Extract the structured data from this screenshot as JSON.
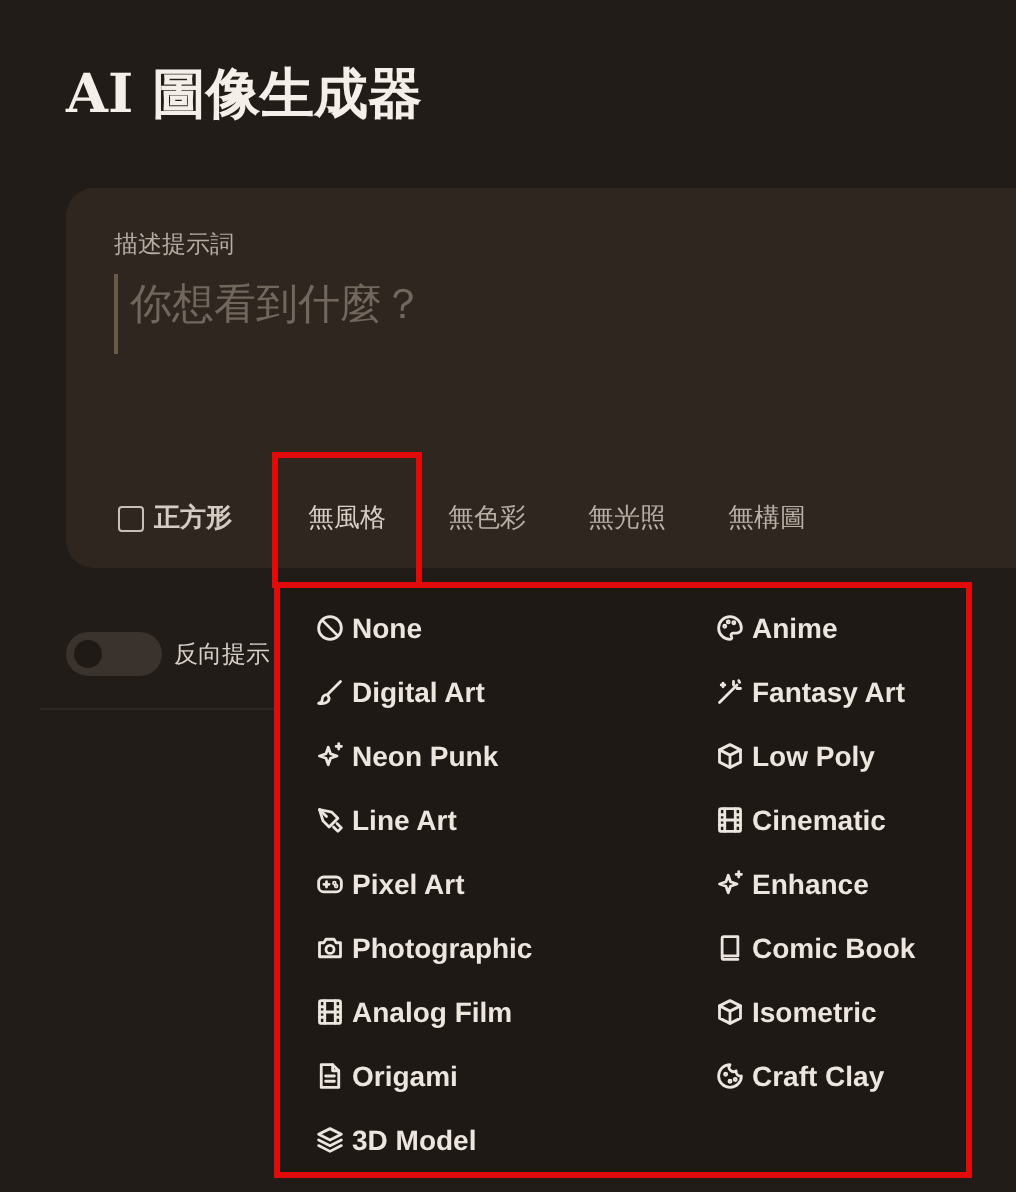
{
  "title": "AI 圖像生成器",
  "prompt": {
    "label": "描述提示詞",
    "placeholder": "你想看到什麼？"
  },
  "options": {
    "square": {
      "label": "正方形",
      "checked": false
    },
    "chips": [
      {
        "label": "無風格",
        "expanded": true,
        "highlighted": true
      },
      {
        "label": "無色彩",
        "expanded": false,
        "highlighted": false
      },
      {
        "label": "無光照",
        "expanded": false,
        "highlighted": false
      },
      {
        "label": "無構圖",
        "expanded": false,
        "highlighted": false
      }
    ]
  },
  "negative_toggle": {
    "label": "反向提示",
    "on": false
  },
  "style_menu": {
    "highlighted": true,
    "items": [
      {
        "label": "None"
      },
      {
        "label": "Anime"
      },
      {
        "label": "Digital Art"
      },
      {
        "label": "Fantasy Art"
      },
      {
        "label": "Neon Punk"
      },
      {
        "label": "Low Poly"
      },
      {
        "label": "Line Art"
      },
      {
        "label": "Cinematic"
      },
      {
        "label": "Pixel Art"
      },
      {
        "label": "Enhance"
      },
      {
        "label": "Photographic"
      },
      {
        "label": "Comic Book"
      },
      {
        "label": "Analog Film"
      },
      {
        "label": "Isometric"
      },
      {
        "label": "Origami"
      },
      {
        "label": "Craft Clay"
      },
      {
        "label": "3D Model"
      }
    ]
  }
}
